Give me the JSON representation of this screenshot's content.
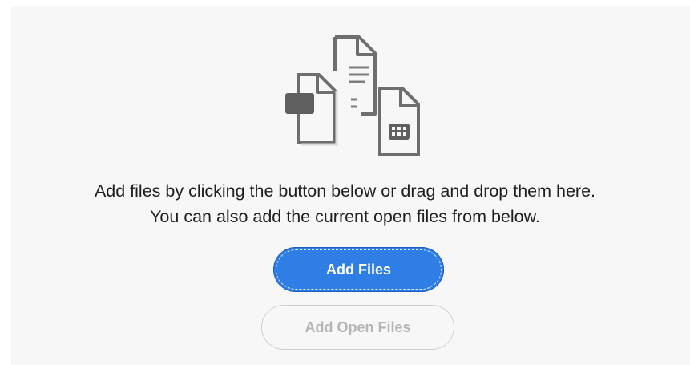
{
  "drop_zone": {
    "icon": "documents-stack-icon",
    "message_line1": "Add files by clicking the button below or drag and drop them here.",
    "message_line2": "You can also add the current open files from below."
  },
  "actions": {
    "add_files_label": "Add Files",
    "add_open_files_label": "Add Open Files",
    "add_open_files_disabled": true
  },
  "colors": {
    "panel_background": "#f7f7f7",
    "primary_button": "#2f7ee6",
    "icon_stroke": "#6e6e6e",
    "disabled_text": "#b5b5b5"
  }
}
